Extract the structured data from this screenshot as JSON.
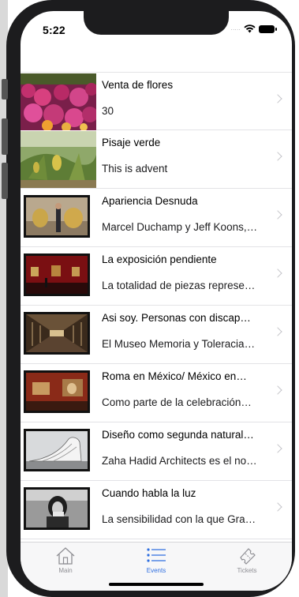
{
  "status": {
    "time": "5:22",
    "signal": "....."
  },
  "items": [
    {
      "title": "Venta de flores",
      "subtitle": "30",
      "thumb": "flowers",
      "framed": false
    },
    {
      "title": "Pisaje verde",
      "subtitle": "This is advent",
      "thumb": "garden",
      "framed": false
    },
    {
      "title": "Apariencia Desnuda",
      "subtitle": "Marcel Duchamp y Jeff Koons,…",
      "thumb": "balloon-dog",
      "framed": true
    },
    {
      "title": "La exposición pendiente",
      "subtitle": "La totalidad de piezas represe…",
      "thumb": "red-gallery",
      "framed": true
    },
    {
      "title": "Asi soy. Personas con discap…",
      "subtitle": "El Museo Memoria y Toleracia…",
      "thumb": "corridor",
      "framed": true
    },
    {
      "title": "Roma en México/ México en…",
      "subtitle": "Como parte de la celebración…",
      "thumb": "painting-room",
      "framed": true
    },
    {
      "title": "Diseño como segunda natural…",
      "subtitle": "Zaha Hadid Architects es el no…",
      "thumb": "building",
      "framed": true
    },
    {
      "title": "Cuando habla la luz",
      "subtitle": "La sensibilidad con la que Gra…",
      "thumb": "portrait",
      "framed": true
    }
  ],
  "tabs": [
    {
      "label": "Main",
      "icon": "home-icon",
      "active": false
    },
    {
      "label": "Events",
      "icon": "list-icon",
      "active": true
    },
    {
      "label": "Tickets",
      "icon": "ticket-icon",
      "active": false
    }
  ],
  "colors": {
    "accent": "#2f6fe0",
    "inactive": "#8e8e93"
  }
}
